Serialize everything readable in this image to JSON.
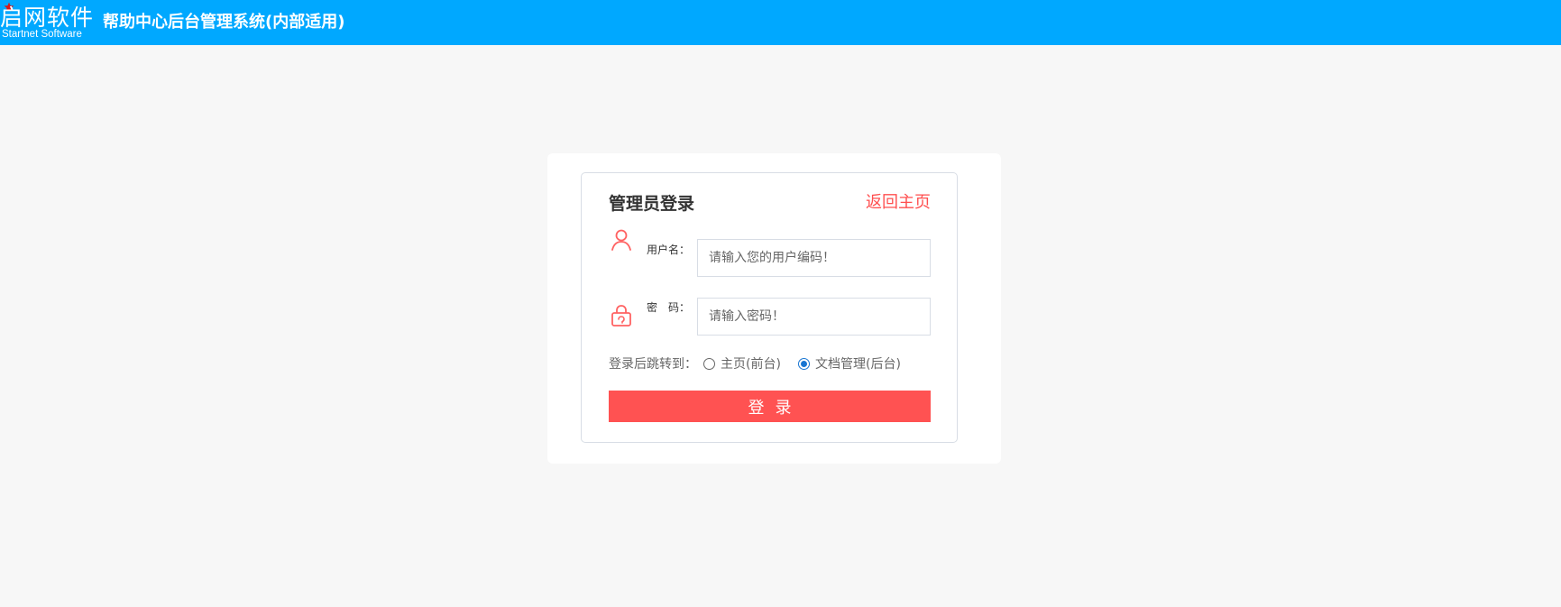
{
  "header": {
    "logo_text": "启网软件",
    "logo_subtitle": "Startnet Software",
    "system_title": "帮助中心后台管理系统(内部适用)"
  },
  "login": {
    "title": "管理员登录",
    "back_link": "返回主页",
    "username_label": "用户名：",
    "username_placeholder": "请输入您的用户编码！",
    "password_label": "密　码：",
    "password_placeholder": "请输入密码！",
    "redirect_label": "登录后跳转到：",
    "redirect_options": [
      {
        "label": "主页(前台)",
        "selected": false
      },
      {
        "label": "文档管理(后台)",
        "selected": true
      }
    ],
    "submit_button": "登录"
  },
  "colors": {
    "header": "#00a8ff",
    "accent": "#ff5252",
    "radio_selected": "#1976d2"
  },
  "icons": {
    "user": "user-icon",
    "password": "lock-icon",
    "logo_star": "star-icon"
  }
}
